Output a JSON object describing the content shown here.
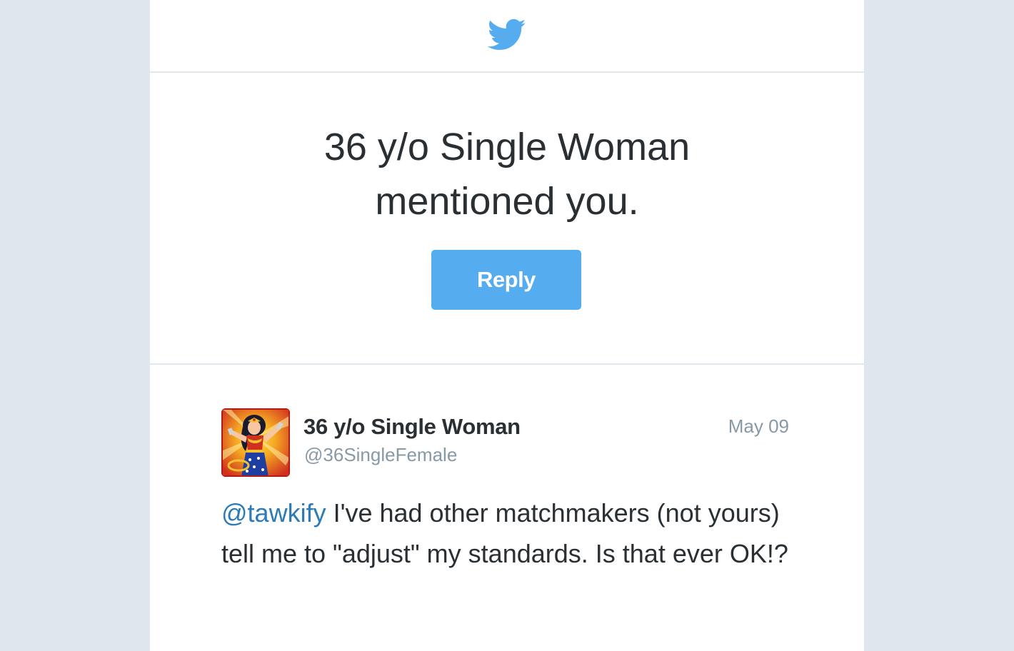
{
  "header": {
    "logo_icon": "twitter-bird-icon",
    "brand_color": "#55acee"
  },
  "notification": {
    "headline_line1": "36 y/o Single Woman",
    "headline_line2": "mentioned you.",
    "reply_label": "Reply"
  },
  "tweet": {
    "avatar_icon": "wonder-woman-avatar",
    "display_name": "36 y/o Single Woman",
    "screen_name": "@36SingleFemale",
    "date": "May 09",
    "mention": "@tawkify",
    "text": " I've had other matchmakers (not yours) tell me to \"adjust\" my standards. Is that ever OK!?",
    "mention_color": "#2b7bb9"
  }
}
